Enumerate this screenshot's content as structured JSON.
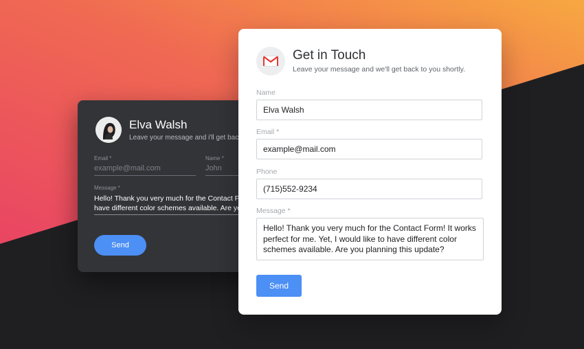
{
  "colors": {
    "gradient_start": "#e94563",
    "gradient_end": "#f7a841",
    "dark_background": "#1f1f22",
    "dark_card": "#333438",
    "accent_blue": "#4c8ff5"
  },
  "dark_form": {
    "name": "Elva Walsh",
    "subtitle": "Leave your message and i'll get back to you shortly.",
    "email_label": "Email *",
    "email_placeholder": "example@mail.com",
    "name_label": "Name *",
    "name_placeholder": "John",
    "message_label": "Message *",
    "message_line1": "Hello! Thank you very much for the Contact Form! It works",
    "message_line2": "have different color schemes available. Are you planning this update?",
    "send_label": "Send",
    "avatar_icon": "person-avatar-icon"
  },
  "contact_form": {
    "title": "Get in Touch",
    "subtitle": "Leave your message and we'll get back to you shortly.",
    "header_icon": "mail-icon",
    "name_label": "Name",
    "name_value": "Elva Walsh",
    "email_label": "Email *",
    "email_value": "example@mail.com",
    "phone_label": "Phone",
    "phone_value": "(715)552-9234",
    "message_label": "Message *",
    "message_value": "Hello! Thank you very much for the Contact Form! It works perfect for me. Yet, I would like to have different color schemes available. Are you planning this update?",
    "send_label": "Send"
  }
}
